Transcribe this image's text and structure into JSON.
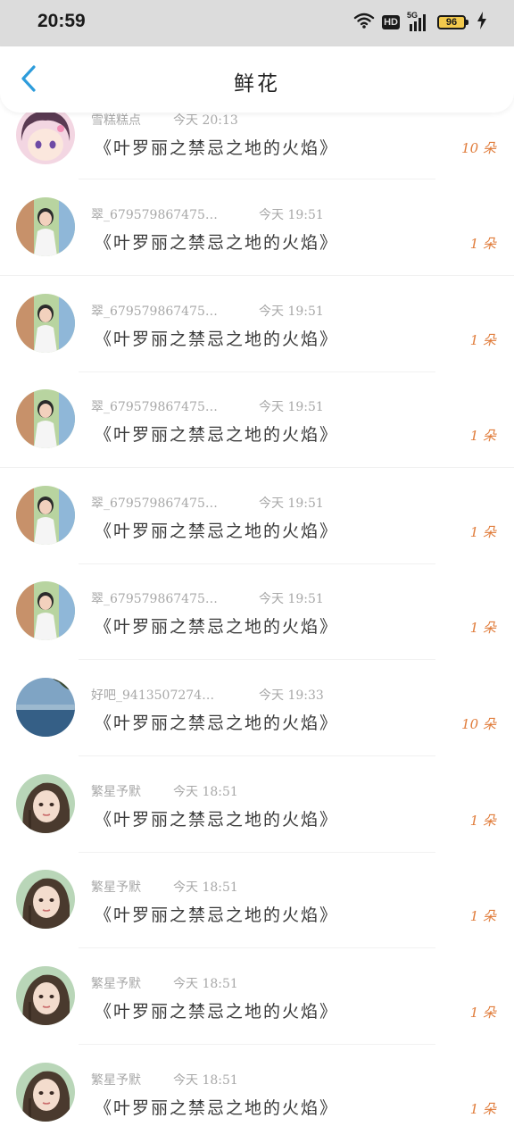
{
  "status_bar": {
    "time": "20:59",
    "network": "5G",
    "hd_label": "HD",
    "battery": "96",
    "icons": [
      "wifi-icon",
      "signal-icon",
      "battery-icon",
      "charging-icon"
    ]
  },
  "header": {
    "title": "鲜花",
    "back_icon": "chevron-left-icon"
  },
  "colors": {
    "accent": "#2d9cdb",
    "count": "#e07b39",
    "meta": "#a8a8a8",
    "text": "#3a3a3a"
  },
  "records": [
    {
      "user": "雪糕糕点",
      "time": "今天 20:13",
      "gift": "《叶罗丽之禁忌之地的火焰》",
      "count": "10 朵",
      "avatar": "anime-girl-avatar"
    },
    {
      "user": "翠_679579867475…",
      "time": "今天 19:51",
      "gift": "《叶罗丽之禁忌之地的火焰》",
      "count": "1 朵",
      "avatar": "child-photo-avatar"
    },
    {
      "user": "翠_679579867475…",
      "time": "今天 19:51",
      "gift": "《叶罗丽之禁忌之地的火焰》",
      "count": "1 朵",
      "avatar": "child-photo-avatar"
    },
    {
      "user": "翠_679579867475…",
      "time": "今天 19:51",
      "gift": "《叶罗丽之禁忌之地的火焰》",
      "count": "1 朵",
      "avatar": "child-photo-avatar"
    },
    {
      "user": "翠_679579867475…",
      "time": "今天 19:51",
      "gift": "《叶罗丽之禁忌之地的火焰》",
      "count": "1 朵",
      "avatar": "child-photo-avatar"
    },
    {
      "user": "翠_679579867475…",
      "time": "今天 19:51",
      "gift": "《叶罗丽之禁忌之地的火焰》",
      "count": "1 朵",
      "avatar": "child-photo-avatar"
    },
    {
      "user": "好吧_9413507274…",
      "time": "今天 19:33",
      "gift": "《叶罗丽之禁忌之地的火焰》",
      "count": "10 朵",
      "avatar": "beach-photo-avatar"
    },
    {
      "user": "繁星予默",
      "time": "今天 18:51",
      "gift": "《叶罗丽之禁忌之地的火焰》",
      "count": "1 朵",
      "avatar": "painted-girl-avatar"
    },
    {
      "user": "繁星予默",
      "time": "今天 18:51",
      "gift": "《叶罗丽之禁忌之地的火焰》",
      "count": "1 朵",
      "avatar": "painted-girl-avatar"
    },
    {
      "user": "繁星予默",
      "time": "今天 18:51",
      "gift": "《叶罗丽之禁忌之地的火焰》",
      "count": "1 朵",
      "avatar": "painted-girl-avatar"
    },
    {
      "user": "繁星予默",
      "time": "今天 18:51",
      "gift": "《叶罗丽之禁忌之地的火焰》",
      "count": "1 朵",
      "avatar": "painted-girl-avatar"
    }
  ]
}
